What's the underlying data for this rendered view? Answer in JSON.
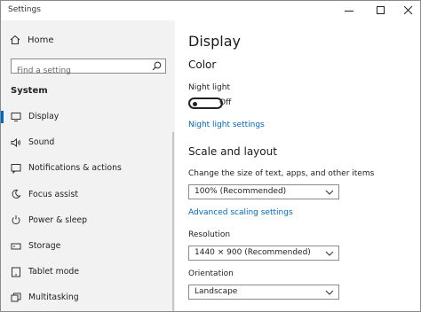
{
  "window": {
    "title": "Settings"
  },
  "sidebar": {
    "home_label": "Home",
    "search_placeholder": "Find a setting",
    "section_label": "System",
    "items": [
      {
        "label": "Display",
        "icon": "display-icon",
        "active": true
      },
      {
        "label": "Sound",
        "icon": "speaker-icon"
      },
      {
        "label": "Notifications & actions",
        "icon": "notification-icon"
      },
      {
        "label": "Focus assist",
        "icon": "moon-icon"
      },
      {
        "label": "Power & sleep",
        "icon": "power-icon"
      },
      {
        "label": "Storage",
        "icon": "storage-icon"
      },
      {
        "label": "Tablet mode",
        "icon": "tablet-icon"
      },
      {
        "label": "Multitasking",
        "icon": "multitasking-icon"
      }
    ]
  },
  "main": {
    "page_title": "Display",
    "color_heading": "Color",
    "night_light_label": "Night light",
    "night_light_state": "Off",
    "night_light_settings_link": "Night light settings",
    "scale_heading": "Scale and layout",
    "scale_label": "Change the size of text, apps, and other items",
    "scale_value": "100% (Recommended)",
    "advanced_scaling_link": "Advanced scaling settings",
    "resolution_label": "Resolution",
    "resolution_value": "1440 × 900 (Recommended)",
    "orientation_label": "Orientation",
    "orientation_value": "Landscape"
  },
  "colors": {
    "accent": "#0067c0",
    "sidebar_bg": "#f2f2f2"
  }
}
